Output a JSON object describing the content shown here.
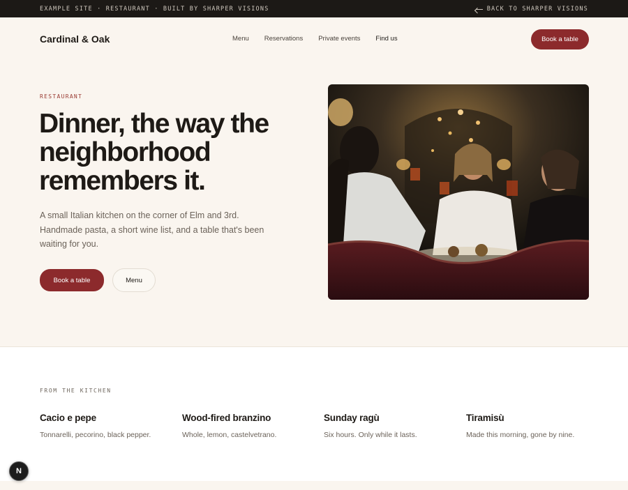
{
  "topbar": {
    "left_text": "EXAMPLE SITE · RESTAURANT · BUILT BY SHARPER VISIONS",
    "back_link": "BACK TO SHARPER VISIONS",
    "back_icon": "arrow-left-icon"
  },
  "header": {
    "brand": "Cardinal & Oak",
    "nav": [
      "Menu",
      "Reservations",
      "Private events",
      "Find us"
    ],
    "cta": "Book a table"
  },
  "hero": {
    "eyebrow": "RESTAURANT",
    "headline": "Dinner, the way the neighborhood remembers it.",
    "lede": "A small Italian kitchen on the corner of Elm and 3rd. Handmade pasta, a short wine list, and a table that's been waiting for you.",
    "primary_button": "Book a table",
    "secondary_button": "Menu"
  },
  "kitchen": {
    "label": "FROM THE KITCHEN",
    "dishes": [
      {
        "name": "Cacio e pepe",
        "desc": "Tonnarelli, pecorino, black pepper."
      },
      {
        "name": "Wood-fired branzino",
        "desc": "Whole, lemon, castelvetrano."
      },
      {
        "name": "Sunday ragù",
        "desc": "Six hours. Only while it lasts."
      },
      {
        "name": "Tiramisù",
        "desc": "Made this morning, gone by nine."
      }
    ]
  },
  "fab": {
    "label": "N"
  },
  "colors": {
    "accent": "#8c2a2c",
    "background": "#faf5ef",
    "topbar": "#1c1916",
    "eyebrow": "#9a3b33"
  }
}
